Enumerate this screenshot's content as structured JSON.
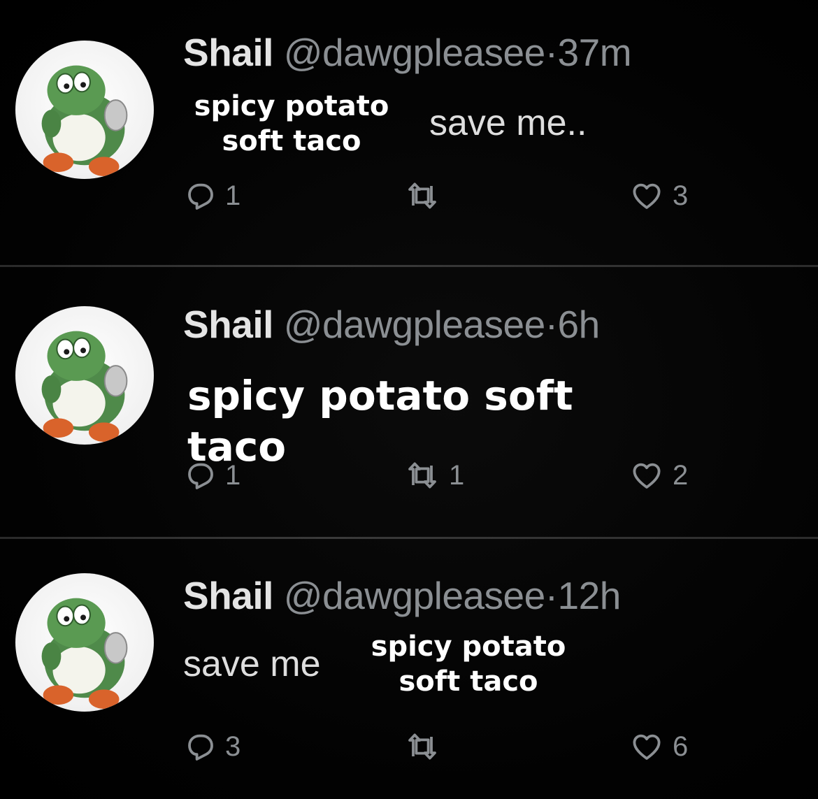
{
  "tweets": [
    {
      "name": "Shail",
      "handle": "@dawgpleasee",
      "separator": "·",
      "time": "37m",
      "text": "save me..",
      "overlay": [
        "spicy potato",
        "soft taco"
      ],
      "replies": "1",
      "retweets": "",
      "likes": "3"
    },
    {
      "name": "Shail",
      "handle": "@dawgpleasee",
      "separator": "·",
      "time": "6h",
      "text": "",
      "overlay": [
        "spicy potato soft taco"
      ],
      "replies": "1",
      "retweets": "1",
      "likes": "2"
    },
    {
      "name": "Shail",
      "handle": "@dawgpleasee",
      "separator": "·",
      "time": "12h",
      "text": "save me",
      "overlay": [
        "spicy potato",
        "soft taco"
      ],
      "replies": "3",
      "retweets": "",
      "likes": "6"
    }
  ],
  "icons": {
    "reply": "reply-icon",
    "retweet": "retweet-icon",
    "like": "heart-icon",
    "avatar": "yoshi-avatar"
  },
  "colors": {
    "background": "#000000",
    "name": "#e4e4e4",
    "muted": "#8b8f93",
    "overlay_text": "#ffffff"
  }
}
